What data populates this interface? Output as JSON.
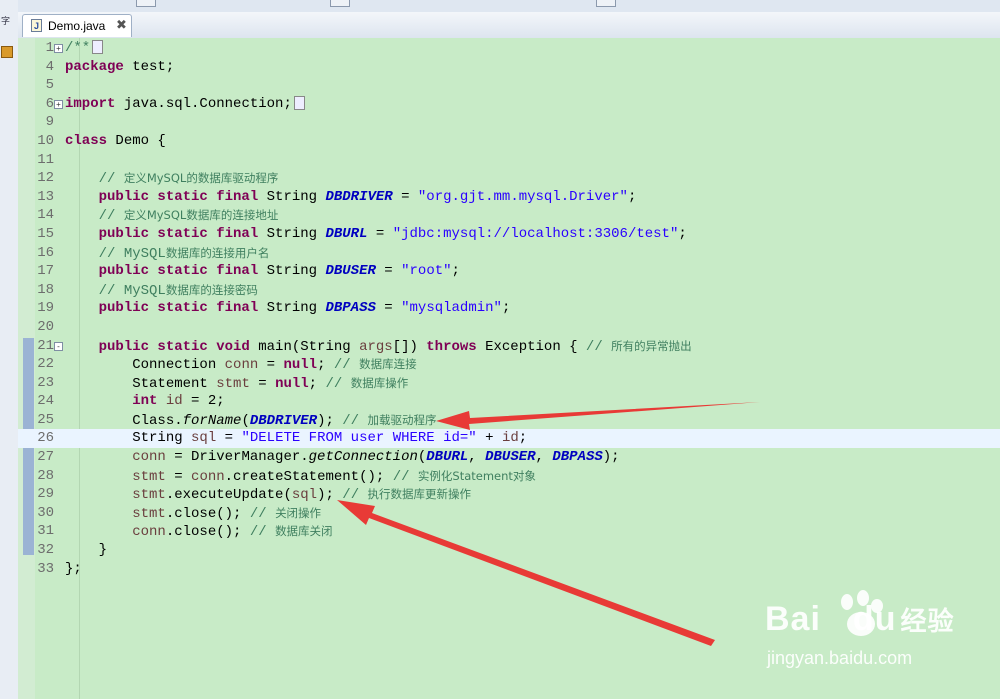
{
  "tab": {
    "title": "Demo.java",
    "icon": "java-file-icon",
    "close_glyph": "✖"
  },
  "code_lines": [
    {
      "n": "1",
      "fold": "+",
      "segs": [
        [
          "cm",
          "/**"
        ],
        [
          "box",
          ""
        ]
      ]
    },
    {
      "n": "4",
      "segs": [
        [
          "kw",
          "package"
        ],
        [
          "t",
          " test;"
        ]
      ]
    },
    {
      "n": "5",
      "segs": []
    },
    {
      "n": "6",
      "fold": "+",
      "segs": [
        [
          "kw",
          "import"
        ],
        [
          "t",
          " java.sql.Connection;"
        ],
        [
          "box",
          ""
        ]
      ]
    },
    {
      "n": "9",
      "segs": []
    },
    {
      "n": "10",
      "segs": [
        [
          "kw",
          "class"
        ],
        [
          "t",
          " Demo {"
        ]
      ]
    },
    {
      "n": "11",
      "segs": []
    },
    {
      "n": "12",
      "segs": [
        [
          "t",
          "    "
        ],
        [
          "cm",
          "// "
        ],
        [
          "cn",
          "定义MySQL的数据库驱动程序"
        ]
      ]
    },
    {
      "n": "13",
      "segs": [
        [
          "t",
          "    "
        ],
        [
          "kw",
          "public static final"
        ],
        [
          "t",
          " String "
        ],
        [
          "cst",
          "DBDRIVER"
        ],
        [
          "t",
          " = "
        ],
        [
          "str",
          "\"org.gjt.mm.mysql.Driver\""
        ],
        [
          "t",
          ";"
        ]
      ]
    },
    {
      "n": "14",
      "segs": [
        [
          "t",
          "    "
        ],
        [
          "cm",
          "// "
        ],
        [
          "cn",
          "定义MySQL数据库的连接地址"
        ]
      ]
    },
    {
      "n": "15",
      "segs": [
        [
          "t",
          "    "
        ],
        [
          "kw",
          "public static final"
        ],
        [
          "t",
          " String "
        ],
        [
          "cst",
          "DBURL"
        ],
        [
          "t",
          " = "
        ],
        [
          "str",
          "\"jdbc:mysql://localhost:3306/test\""
        ],
        [
          "t",
          ";"
        ]
      ]
    },
    {
      "n": "16",
      "segs": [
        [
          "t",
          "    "
        ],
        [
          "cm",
          "// MySQL"
        ],
        [
          "cn",
          "数据库的连接用户名"
        ]
      ]
    },
    {
      "n": "17",
      "segs": [
        [
          "t",
          "    "
        ],
        [
          "kw",
          "public static final"
        ],
        [
          "t",
          " String "
        ],
        [
          "cst",
          "DBUSER"
        ],
        [
          "t",
          " = "
        ],
        [
          "str",
          "\"root\""
        ],
        [
          "t",
          ";"
        ]
      ]
    },
    {
      "n": "18",
      "segs": [
        [
          "t",
          "    "
        ],
        [
          "cm",
          "// MySQL"
        ],
        [
          "cn",
          "数据库的连接密码"
        ]
      ]
    },
    {
      "n": "19",
      "segs": [
        [
          "t",
          "    "
        ],
        [
          "kw",
          "public static final"
        ],
        [
          "t",
          " String "
        ],
        [
          "cst",
          "DBPASS"
        ],
        [
          "t",
          " = "
        ],
        [
          "str",
          "\"mysqladmin\""
        ],
        [
          "t",
          ";"
        ]
      ]
    },
    {
      "n": "20",
      "segs": []
    },
    {
      "n": "21",
      "fold": "-",
      "segs": [
        [
          "t",
          "    "
        ],
        [
          "kw",
          "public static void"
        ],
        [
          "t",
          " main(String "
        ],
        [
          "lv",
          "args"
        ],
        [
          "t",
          "[]) "
        ],
        [
          "kw",
          "throws"
        ],
        [
          "t",
          " Exception { "
        ],
        [
          "cm",
          "// "
        ],
        [
          "cn",
          "所有的异常抛出"
        ]
      ]
    },
    {
      "n": "22",
      "segs": [
        [
          "t",
          "        Connection "
        ],
        [
          "lv",
          "conn"
        ],
        [
          "t",
          " = "
        ],
        [
          "kw",
          "null"
        ],
        [
          "t",
          "; "
        ],
        [
          "cm",
          "// "
        ],
        [
          "cn",
          "数据库连接"
        ]
      ]
    },
    {
      "n": "23",
      "segs": [
        [
          "t",
          "        Statement "
        ],
        [
          "lv",
          "stmt"
        ],
        [
          "t",
          " = "
        ],
        [
          "kw",
          "null"
        ],
        [
          "t",
          "; "
        ],
        [
          "cm",
          "// "
        ],
        [
          "cn",
          "数据库操作"
        ]
      ]
    },
    {
      "n": "24",
      "segs": [
        [
          "t",
          "        "
        ],
        [
          "kw",
          "int"
        ],
        [
          "t",
          " "
        ],
        [
          "lv",
          "id"
        ],
        [
          "t",
          " = 2;"
        ]
      ]
    },
    {
      "n": "25",
      "segs": [
        [
          "t",
          "        Class."
        ],
        [
          "sm",
          "forName"
        ],
        [
          "t",
          "("
        ],
        [
          "cst",
          "DBDRIVER"
        ],
        [
          "t",
          "); "
        ],
        [
          "cm",
          "// "
        ],
        [
          "cn",
          "加载驱动程序"
        ]
      ]
    },
    {
      "n": "26",
      "current": true,
      "segs": [
        [
          "t",
          "        String "
        ],
        [
          "lv",
          "sql"
        ],
        [
          "t",
          " = "
        ],
        [
          "str",
          "\"DELETE FROM user WHERE id=\""
        ],
        [
          "t",
          " + "
        ],
        [
          "lv",
          "id"
        ],
        [
          "t",
          ";"
        ]
      ]
    },
    {
      "n": "27",
      "segs": [
        [
          "t",
          "        "
        ],
        [
          "lv",
          "conn"
        ],
        [
          "t",
          " = DriverManager."
        ],
        [
          "sm",
          "getConnection"
        ],
        [
          "t",
          "("
        ],
        [
          "cst",
          "DBURL"
        ],
        [
          "t",
          ", "
        ],
        [
          "cst",
          "DBUSER"
        ],
        [
          "t",
          ", "
        ],
        [
          "cst",
          "DBPASS"
        ],
        [
          "t",
          ");"
        ]
      ]
    },
    {
      "n": "28",
      "segs": [
        [
          "t",
          "        "
        ],
        [
          "lv",
          "stmt"
        ],
        [
          "t",
          " = "
        ],
        [
          "lv",
          "conn"
        ],
        [
          "t",
          ".createStatement(); "
        ],
        [
          "cm",
          "// "
        ],
        [
          "cn",
          "实例化Statement对象"
        ]
      ]
    },
    {
      "n": "29",
      "segs": [
        [
          "t",
          "        "
        ],
        [
          "lv",
          "stmt"
        ],
        [
          "t",
          ".executeUpdate("
        ],
        [
          "lv",
          "sql"
        ],
        [
          "t",
          "); "
        ],
        [
          "cm",
          "// "
        ],
        [
          "cn",
          "执行数据库更新操作"
        ]
      ]
    },
    {
      "n": "30",
      "segs": [
        [
          "t",
          "        "
        ],
        [
          "lv",
          "stmt"
        ],
        [
          "t",
          ".close(); "
        ],
        [
          "cm",
          "// "
        ],
        [
          "cn",
          "关闭操作"
        ]
      ]
    },
    {
      "n": "31",
      "segs": [
        [
          "t",
          "        "
        ],
        [
          "lv",
          "conn"
        ],
        [
          "t",
          ".close(); "
        ],
        [
          "cm",
          "// "
        ],
        [
          "cn",
          "数据库关闭"
        ]
      ]
    },
    {
      "n": "32",
      "segs": [
        [
          "t",
          "    }"
        ]
      ]
    },
    {
      "n": "33",
      "segs": [
        [
          "t",
          "};"
        ]
      ]
    }
  ],
  "side_strip": {
    "glyph": "字"
  },
  "colors": {
    "editor_bg": "#c8ebc7",
    "current_line": "#eaf4ff",
    "arrow": "#e83a36",
    "keyword": "#7f0055",
    "string": "#2a00ff",
    "comment": "#3f7f5f",
    "constant": "#0000c0"
  },
  "watermark": {
    "logo_text": "Bai",
    "logo_suffix": "du",
    "logo_cn": "经验",
    "url": "jingyan.baidu.com"
  }
}
